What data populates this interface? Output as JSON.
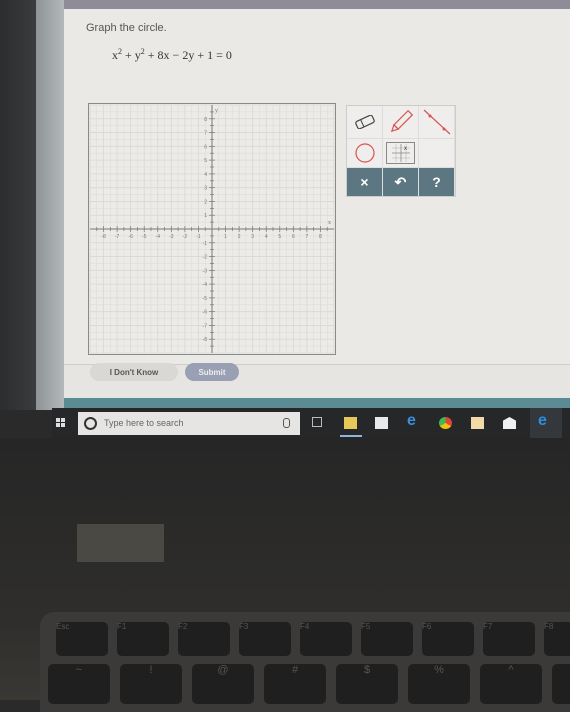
{
  "page": {
    "title": "Graph the circle.",
    "equation": {
      "parts": [
        "x",
        "2",
        " + y",
        "2",
        " + 8x − 2y + 1 = 0"
      ]
    }
  },
  "graph": {
    "x_axis_label": "x",
    "y_axis_label": "y",
    "x_range": [
      -9,
      9
    ],
    "y_range": [
      -9,
      9
    ],
    "x_tick_labels": [
      "-8",
      "-7",
      "-6",
      "-5",
      "-4",
      "-3",
      "-2",
      "-1",
      "1",
      "2",
      "3",
      "4",
      "5",
      "6",
      "7",
      "8"
    ],
    "y_tick_labels": [
      "8",
      "7",
      "6",
      "5",
      "4",
      "3",
      "2",
      "1",
      "-1",
      "-2",
      "-3",
      "-4",
      "-5",
      "-6",
      "-7",
      "-8"
    ],
    "minor_step": 0.5
  },
  "tools": {
    "items": [
      {
        "name": "eraser-tool",
        "icon": "eraser-icon"
      },
      {
        "name": "pencil-tool",
        "icon": "pencil-icon"
      },
      {
        "name": "line-tool",
        "icon": "line-icon"
      },
      {
        "name": "circle-tool",
        "icon": "circle-icon"
      },
      {
        "name": "graph-point-tool",
        "icon": "graph-point-icon"
      }
    ],
    "actions": [
      {
        "name": "clear-button",
        "label": "×"
      },
      {
        "name": "undo-button",
        "label": "↶"
      },
      {
        "name": "help-button",
        "label": "?"
      }
    ],
    "colors": {
      "accent": "#d9534f",
      "action_bg": "#5c7682"
    }
  },
  "buttons": {
    "dont_know": "I Don't Know",
    "submit": "Submit"
  },
  "taskbar": {
    "search_placeholder": "Type here to search",
    "apps": [
      "task-view",
      "file-explorer",
      "store",
      "internet-explorer",
      "chrome",
      "photos",
      "mail",
      "edge"
    ]
  },
  "keyboard": {
    "fn_keys": [
      "Esc",
      "F1",
      "F2",
      "F3",
      "F4",
      "F5",
      "F6",
      "F7",
      "F8"
    ],
    "num_keys": [
      "~",
      "!",
      "@",
      "#",
      "$",
      "%",
      "^",
      "&"
    ]
  }
}
